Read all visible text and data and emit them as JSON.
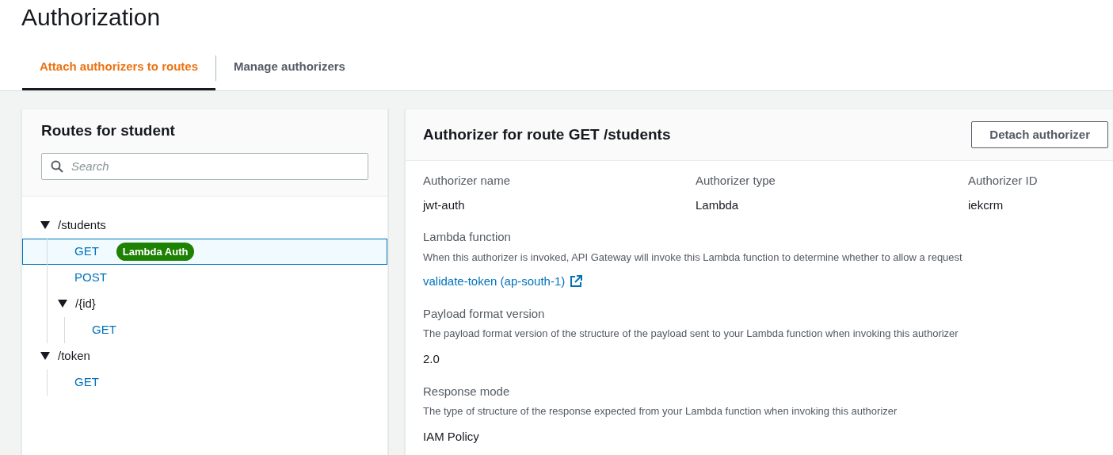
{
  "page_title": "Authorization",
  "tabs": [
    {
      "label": "Attach authorizers to routes",
      "selected": true
    },
    {
      "label": "Manage authorizers",
      "selected": false
    }
  ],
  "routes_panel": {
    "title": "Routes for student",
    "search": {
      "placeholder": "Search"
    },
    "tree": [
      {
        "kind": "path",
        "label": "/students",
        "expanded": true,
        "children": [
          {
            "kind": "method",
            "label": "GET",
            "badge": "Lambda Auth",
            "selected": true
          },
          {
            "kind": "method",
            "label": "POST",
            "selected": false
          },
          {
            "kind": "path",
            "label": "/{id}",
            "expanded": true,
            "children": [
              {
                "kind": "method",
                "label": "GET",
                "selected": false
              }
            ]
          }
        ]
      },
      {
        "kind": "path",
        "label": "/token",
        "expanded": true,
        "children": [
          {
            "kind": "method",
            "label": "GET",
            "selected": false
          }
        ]
      }
    ]
  },
  "detail_panel": {
    "title": "Authorizer for route GET /students",
    "button": "Detach authorizer",
    "fields": [
      {
        "label": "Authorizer name",
        "value": "jwt-auth"
      },
      {
        "label": "Authorizer type",
        "value": "Lambda"
      },
      {
        "label": "Authorizer ID",
        "value": "iekcrm"
      }
    ],
    "sections": [
      {
        "label": "Lambda function",
        "description": "When this authorizer is invoked, API Gateway will invoke this Lambda function to determine whether to allow a request",
        "value": "validate-token (ap-south-1)",
        "kind": "link"
      },
      {
        "label": "Payload format version",
        "description": "The payload format version of the structure of the payload sent to your Lambda function when invoking this authorizer",
        "value": "2.0",
        "kind": "text"
      },
      {
        "label": "Response mode",
        "description": "The type of structure of the response expected from your Lambda function when invoking this authorizer",
        "value": "IAM Policy",
        "kind": "text"
      }
    ]
  }
}
